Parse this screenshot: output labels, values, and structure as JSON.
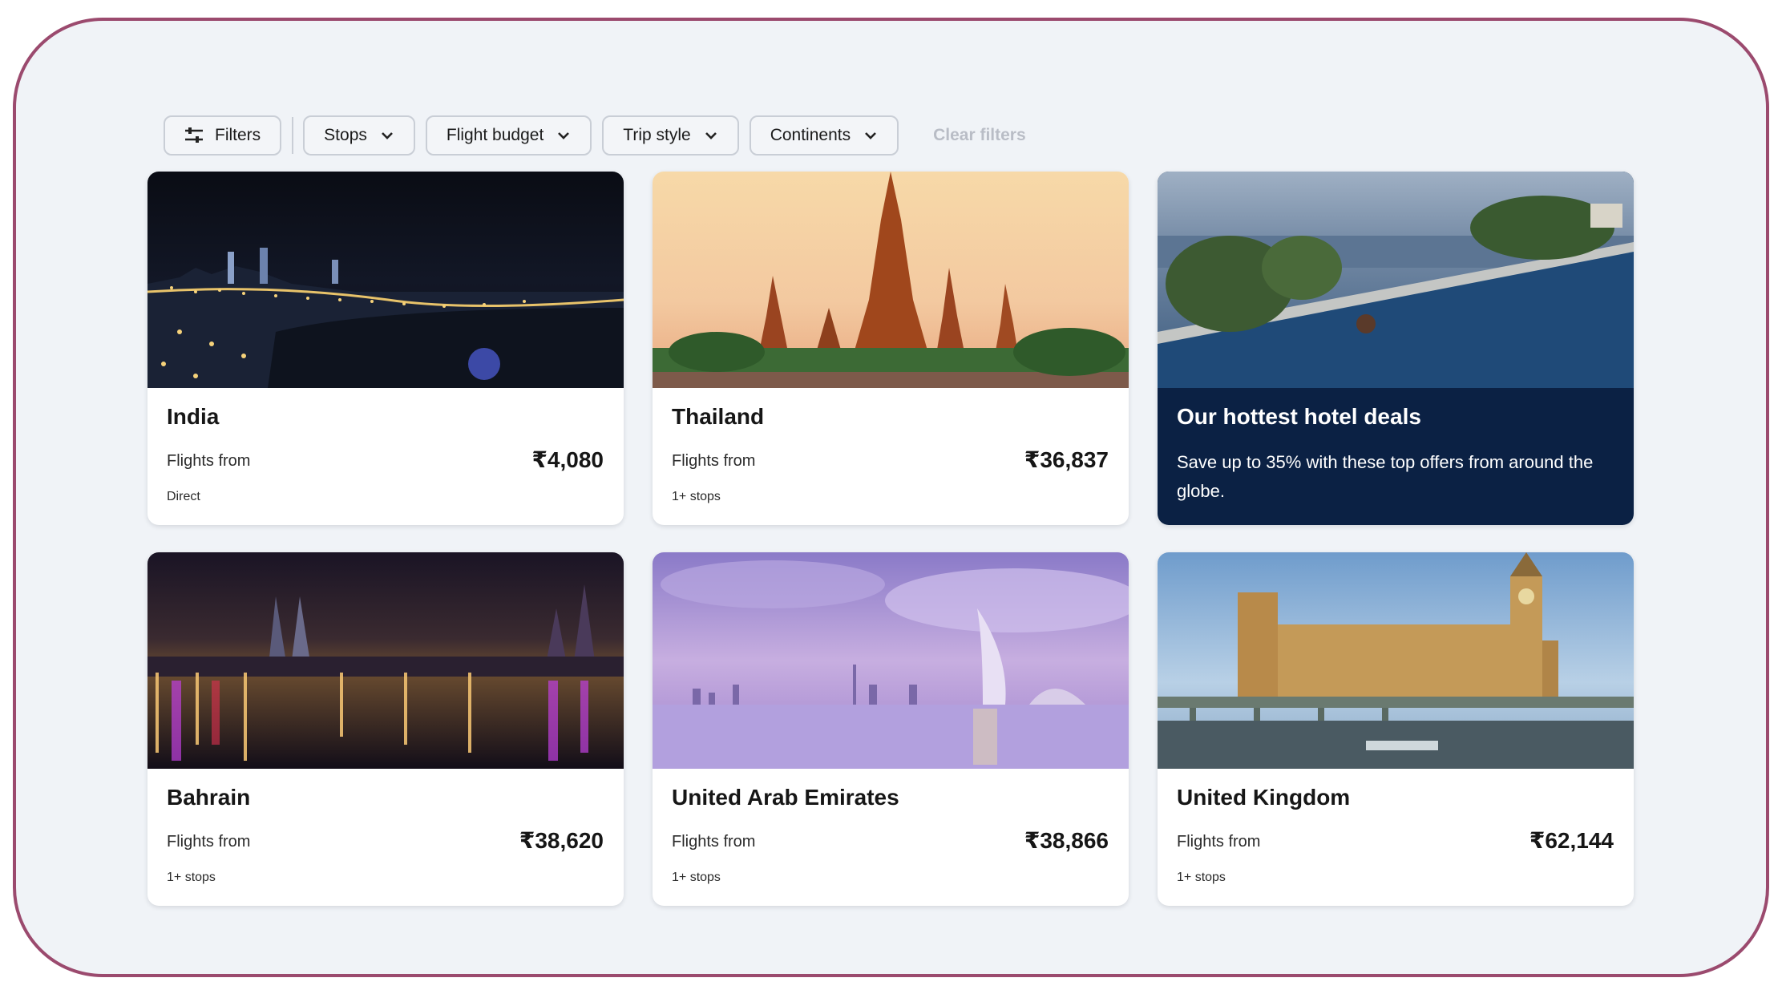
{
  "filters": {
    "filters_label": "Filters",
    "stops_label": "Stops",
    "flight_budget_label": "Flight budget",
    "trip_style_label": "Trip style",
    "continents_label": "Continents",
    "clear_label": "Clear filters"
  },
  "cards": [
    {
      "title": "India",
      "flights_from": "Flights from",
      "price": "₹4,080",
      "stops": "Direct"
    },
    {
      "title": "Thailand",
      "flights_from": "Flights from",
      "price": "₹36,837",
      "stops": "1+ stops"
    },
    {
      "title": "Bahrain",
      "flights_from": "Flights from",
      "price": "₹38,620",
      "stops": "1+ stops"
    },
    {
      "title": "United Arab Emirates",
      "flights_from": "Flights from",
      "price": "₹38,866",
      "stops": "1+ stops"
    },
    {
      "title": "United Kingdom",
      "flights_from": "Flights from",
      "price": "₹62,144",
      "stops": "1+ stops"
    }
  ],
  "promo": {
    "title": "Our hottest hotel deals",
    "text": "Save up to 35% with these top offers from around the globe."
  },
  "colors": {
    "frame_border": "#9b4a6e",
    "page_bg": "#f0f3f7",
    "promo_bg": "#0b2144"
  }
}
